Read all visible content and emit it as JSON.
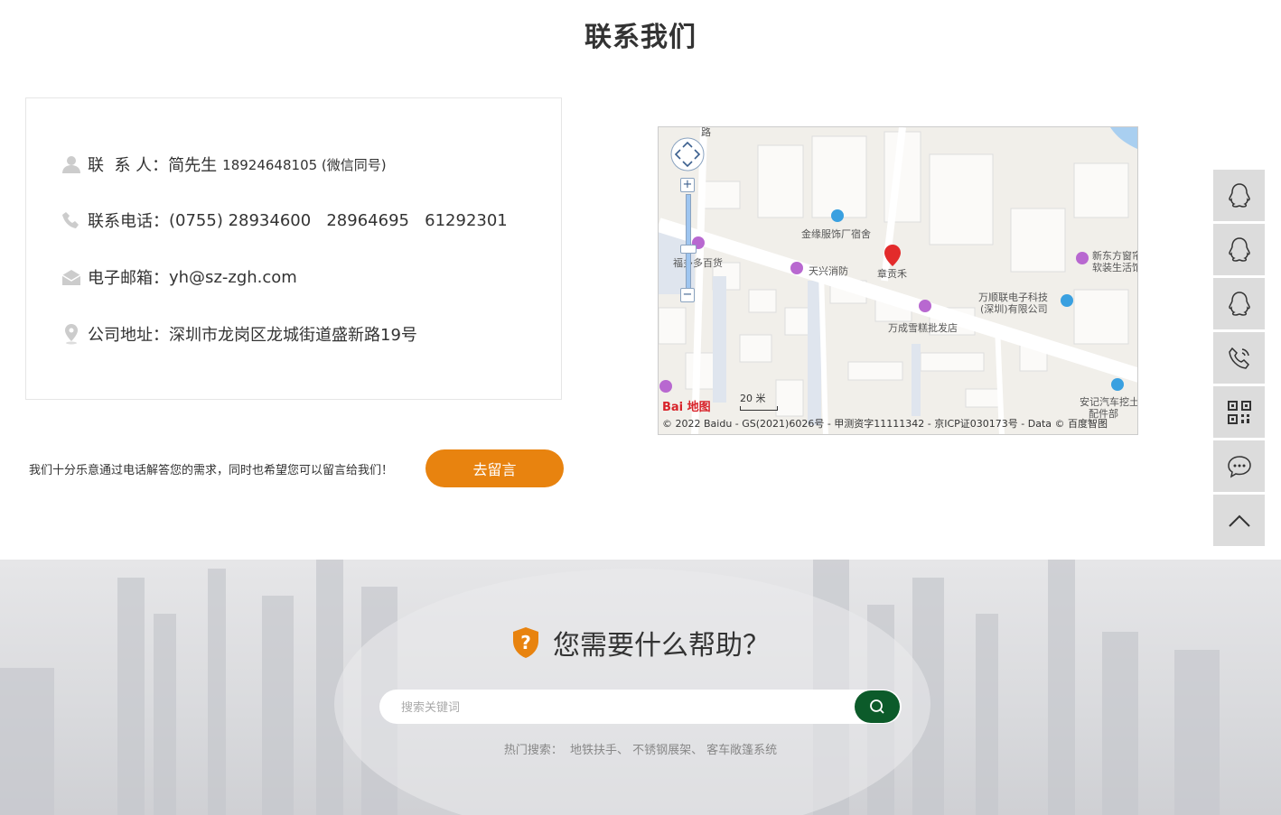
{
  "page": {
    "title": "联系我们"
  },
  "contact": {
    "person_label": "联  系 人：",
    "person_name": "简先生",
    "person_phone": "18924648105 (微信同号)",
    "tel_label": "联系电话：",
    "tel_value": "(0755) 28934600   28964695   61292301",
    "email_label": "电子邮箱：",
    "email_value": "yh@sz-zgh.com",
    "address_label": "公司地址：",
    "address_value": "深圳市龙岗区龙城街道盛新路19号"
  },
  "message": {
    "note": "我们十分乐意通过电话解答您的需求，同时也希望您可以留言给我们！",
    "button": "去留言"
  },
  "map": {
    "labels": [
      "路",
      "金缘服饰厂宿舍",
      "福多多百货",
      "天兴消防",
      "章贡禾",
      "新东方窗帘",
      "软装生活馆",
      "万顺联电子科技",
      "(深圳)有限公司",
      "万成雪糕批发店",
      "安记汽车挖土",
      "配件部"
    ],
    "scale": "20 米",
    "logo": "Bai 地图",
    "copyright": "© 2022 Baidu - GS(2021)6026号 - 甲测资字11111342 - 京ICP证030173号 - Data © 百度智图"
  },
  "sidebar": {
    "items": [
      "qq-icon",
      "qq-icon",
      "qq-icon",
      "phone-icon",
      "qrcode-icon",
      "chat-icon",
      "arrow-up-icon"
    ]
  },
  "help": {
    "title": "您需要什么帮助？",
    "search_placeholder": "搜索关键词",
    "hot_label": "热门搜索：",
    "hot_items": [
      "地铁扶手、",
      "不锈钢展架、",
      "客车敞篷系统"
    ]
  },
  "colors": {
    "accent": "#e8830f",
    "search_button": "#0c5b2a",
    "sidebar": "#dcdcdc"
  }
}
